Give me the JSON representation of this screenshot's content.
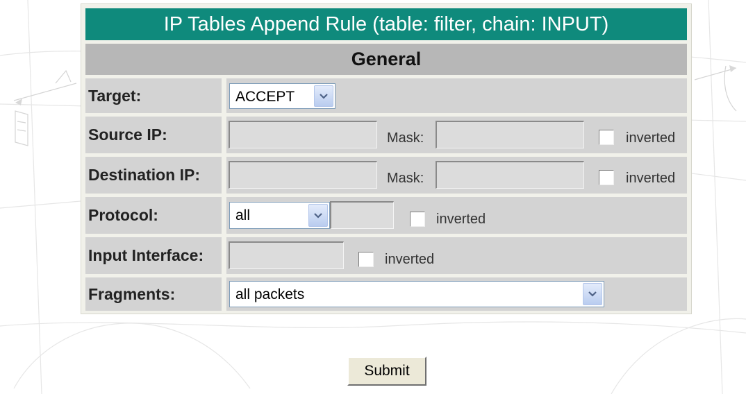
{
  "form": {
    "title": "IP Tables Append Rule (table: filter, chain: INPUT)",
    "section_header": "General",
    "target": {
      "label": "Target:",
      "selected": "ACCEPT"
    },
    "source_ip": {
      "label": "Source IP:",
      "value": "",
      "mask_label": "Mask:",
      "mask_value": "",
      "inverted_label": "inverted"
    },
    "destination_ip": {
      "label": "Destination IP:",
      "value": "",
      "mask_label": "Mask:",
      "mask_value": "",
      "inverted_label": "inverted"
    },
    "protocol": {
      "label": "Protocol:",
      "selected": "all",
      "value": "",
      "inverted_label": "inverted"
    },
    "input_interface": {
      "label": "Input Interface:",
      "value": "",
      "inverted_label": "inverted"
    },
    "fragments": {
      "label": "Fragments:",
      "selected": "all packets"
    },
    "submit_label": "Submit"
  },
  "colors": {
    "title_bar": "#0f8a7c",
    "section_bar": "#b7b7b7",
    "row_cell": "#d3d3d3",
    "dropdown_arrow": "#4d6185"
  },
  "icons": {
    "dropdown_arrow": "chevron-down-icon"
  }
}
